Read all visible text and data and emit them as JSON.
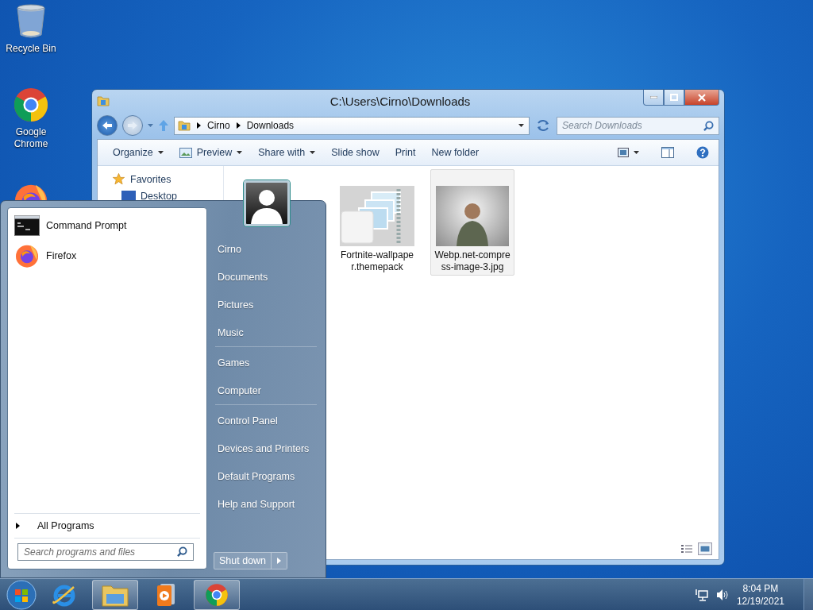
{
  "desktop_icons": [
    {
      "kind": "recycle",
      "label": "Recycle Bin"
    },
    {
      "kind": "chrome",
      "label": "Google Chrome"
    },
    {
      "kind": "firefox"
    }
  ],
  "explorer": {
    "title": "C:\\Users\\Cirno\\Downloads",
    "crumbs": [
      "Cirno",
      "Downloads"
    ],
    "search": {
      "placeholder": "Search Downloads"
    },
    "toolbar": [
      {
        "label": "Organize",
        "dropdown": true,
        "kind": "text"
      },
      {
        "label": "Preview",
        "dropdown": true,
        "kind": "preview"
      },
      {
        "label": "Share with",
        "dropdown": true,
        "kind": "text"
      },
      {
        "label": "Slide show",
        "dropdown": false,
        "kind": "text"
      },
      {
        "label": "Print",
        "dropdown": false,
        "kind": "text"
      },
      {
        "label": "New folder",
        "dropdown": false,
        "kind": "text"
      }
    ],
    "nav": [
      {
        "kind": "favorites",
        "label": "Favorites"
      },
      {
        "kind": "desktop",
        "label": "Desktop"
      }
    ],
    "files": [
      {
        "kind": "themepack",
        "name": "Fortnite-wallpaper.themepack",
        "selected": false
      },
      {
        "kind": "image",
        "name": "Webp.net-compress-image-3.jpg",
        "selected": true
      }
    ]
  },
  "start_menu": {
    "pinned": [
      {
        "kind": "cmd",
        "label": "Command Prompt"
      },
      {
        "kind": "firefox",
        "label": "Firefox"
      }
    ],
    "all_programs": "All Programs",
    "search": {
      "placeholder": "Search programs and files"
    },
    "place_groups": [
      [
        "Cirno",
        "Documents",
        "Pictures",
        "Music"
      ],
      [
        "Games",
        "Computer"
      ],
      [
        "Control Panel",
        "Devices and Printers",
        "Default Programs",
        "Help and Support"
      ]
    ],
    "shut_down": "Shut down"
  },
  "taskbar": {
    "items": [
      {
        "kind": "ie",
        "active": false
      },
      {
        "kind": "explorer",
        "active": true
      },
      {
        "kind": "media",
        "active": false
      },
      {
        "kind": "chrome",
        "active": true
      }
    ],
    "time": "8:04 PM",
    "date": "12/19/2021"
  }
}
